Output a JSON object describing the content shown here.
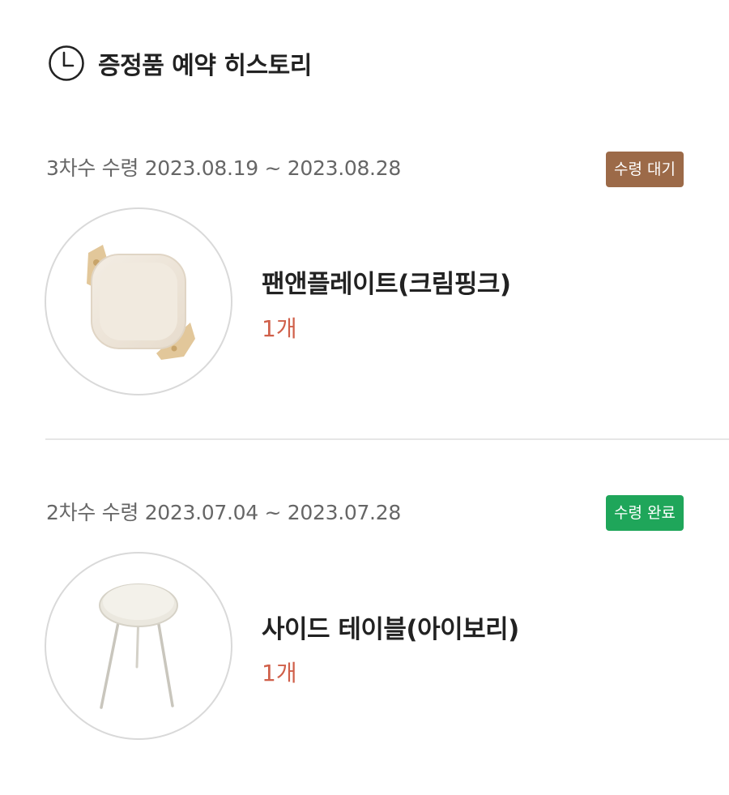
{
  "header": {
    "title": "증정품 예약 히스토리",
    "icon": "clock-icon"
  },
  "history": [
    {
      "period": "3차수 수령 2023.08.19 ~ 2023.08.28",
      "status": "수령 대기",
      "status_color": "#9c6a48",
      "product_name": "팬앤플레이트(크림핑크)",
      "quantity": "1개"
    },
    {
      "period": "2차수 수령 2023.07.04 ~ 2023.07.28",
      "status": "수령 완료",
      "status_color": "#1fa65a",
      "product_name": "사이드 테이블(아이보리)",
      "quantity": "1개"
    }
  ],
  "colors": {
    "quantity": "#d0604a",
    "period_text": "#666666",
    "divider": "#e6e6e6"
  }
}
